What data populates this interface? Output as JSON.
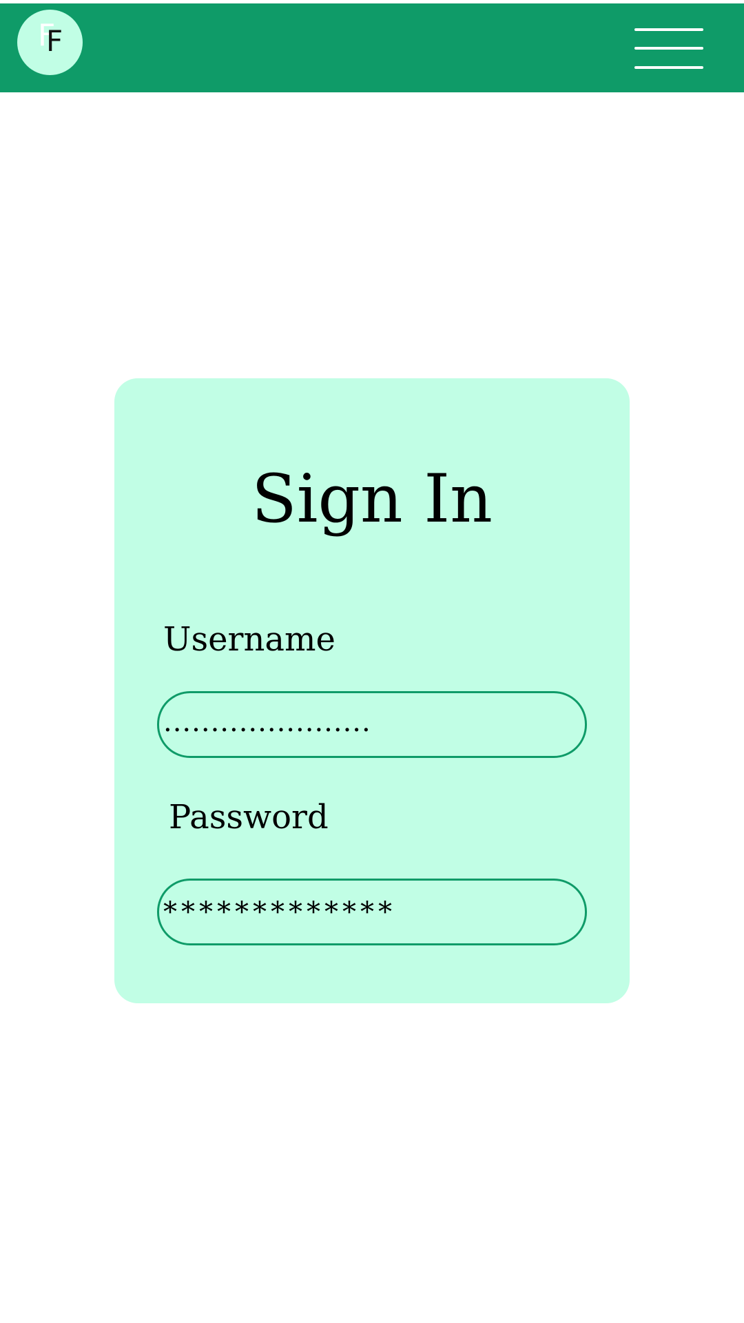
{
  "header": {
    "logo_letter": "F",
    "menu_icon": "hamburger-menu-icon",
    "bg_color": "#0f9b68"
  },
  "signin": {
    "title": "Sign In",
    "username_label": "Username",
    "username_value": "......................",
    "password_label": "Password",
    "password_value": "*************",
    "card_color": "#c1fee5",
    "accent_color": "#0f9b68"
  }
}
